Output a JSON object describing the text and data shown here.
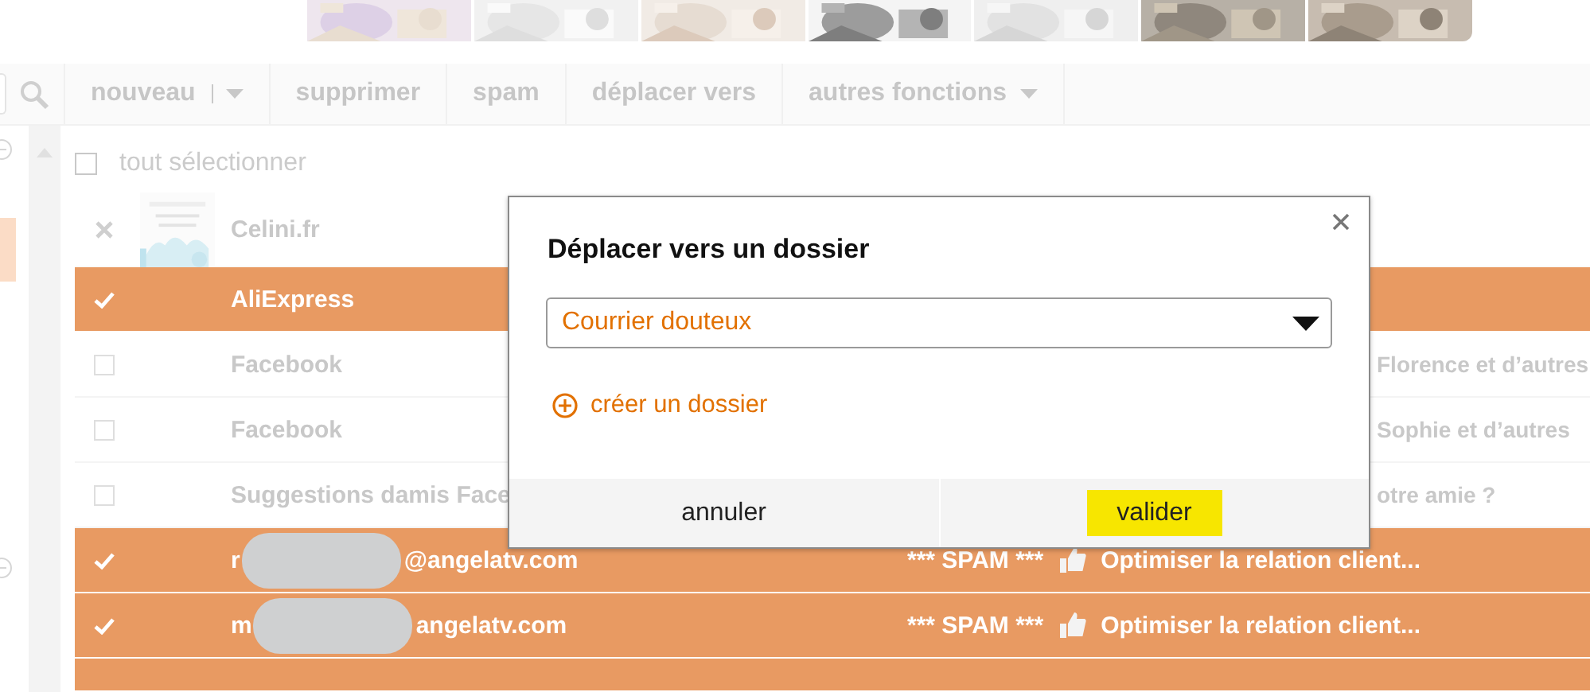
{
  "toolbar": {
    "buttons": [
      {
        "label": "nouveau",
        "kind": "split"
      },
      {
        "label": "supprimer",
        "kind": "plain"
      },
      {
        "label": "spam",
        "kind": "plain"
      },
      {
        "label": "déplacer vers",
        "kind": "plain"
      },
      {
        "label": "autres fonctions",
        "kind": "dropdown"
      }
    ]
  },
  "select_all": {
    "label": "tout sélectionner",
    "checked": false
  },
  "messages": [
    {
      "sender": "Celini.fr",
      "selected": false,
      "hovered": true
    },
    {
      "sender": "AliExpress",
      "selected": true,
      "hovered": false
    },
    {
      "sender": "Facebook",
      "preview": "Florence et d’autres",
      "selected": false,
      "hovered": false
    },
    {
      "sender": "Facebook",
      "preview": "Sophie et d’autres",
      "selected": false,
      "hovered": false
    },
    {
      "sender": "Suggestions damis Face",
      "preview": "otre amie ?",
      "selected": false,
      "hovered": false
    },
    {
      "sender_start": "r",
      "redacted": true,
      "sender": "@angelatv.com",
      "spam_tag": "*** SPAM ***",
      "subject": "Optimiser la relation client...",
      "selected": true,
      "hovered": false
    },
    {
      "sender_start": "m",
      "redacted": true,
      "sender": "angelatv.com",
      "spam_tag": "*** SPAM ***",
      "subject": "Optimiser la relation client...",
      "selected": true,
      "hovered": false
    }
  ],
  "dialog": {
    "title": "Déplacer vers un dossier",
    "folder": "Courrier douteux",
    "create_link": "créer un dossier",
    "buttons": [
      {
        "label": "annuler",
        "kind": "secondary"
      },
      {
        "label": "valider",
        "kind": "primary"
      }
    ]
  }
}
